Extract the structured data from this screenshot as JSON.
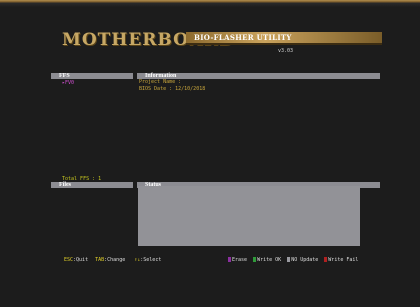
{
  "header": {
    "brand": "MOTHERBOARD",
    "utility_title": "BIO-FLASHER UTILITY",
    "version": "v3.03"
  },
  "ffs": {
    "title": "FFS",
    "items": [
      "FV0"
    ],
    "total": "Total FFS : 1"
  },
  "information": {
    "title": "Information",
    "project_name": "Project Name :",
    "bios_date": "BIOS Date    : 12/10/2018"
  },
  "files": {
    "title": "Files"
  },
  "status": {
    "title": "Status"
  },
  "footer": {
    "esc_key": "ESC",
    "esc_action": ":Quit",
    "tab_key": "TAB",
    "tab_action": ":Change",
    "arrows_key": "↑↓",
    "arrows_action": ":Select"
  },
  "legend": [
    {
      "label": "Erase",
      "color": "#8b2fa0"
    },
    {
      "label": "Write OK",
      "color": "#2f9a3a"
    },
    {
      "label": "NO Update",
      "color": "#9a9aa0"
    },
    {
      "label": "Write Fail",
      "color": "#b02020"
    }
  ]
}
